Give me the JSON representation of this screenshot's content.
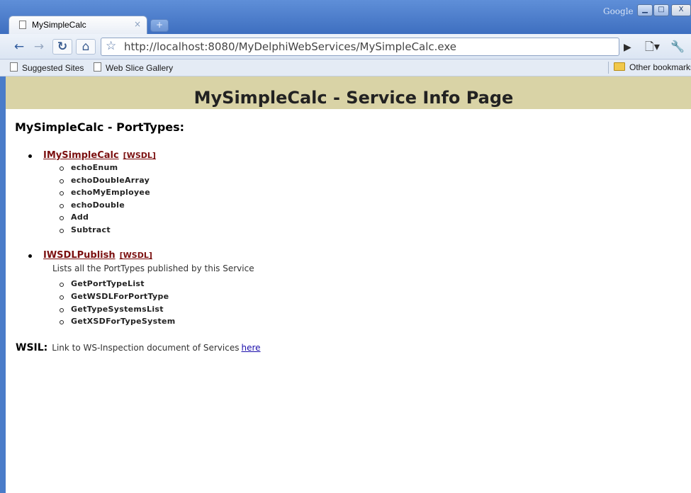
{
  "browser": {
    "tab_title": "MySimpleCalc",
    "tab_close": "×",
    "new_tab": "+",
    "brand": "Google",
    "window_controls": {
      "minimize": "▁",
      "maximize": "□",
      "close": "X"
    },
    "url": "http://localhost:8080/MyDelphiWebServices/MySimpleCalc.exe",
    "bookmarks": [
      {
        "label": "Suggested Sites"
      },
      {
        "label": "Web Slice Gallery"
      }
    ],
    "other_bookmarks": "Other bookmarks"
  },
  "page": {
    "title": "MySimpleCalc - Service Info Page",
    "porttypes_heading": "MySimpleCalc - PortTypes:",
    "porttypes": [
      {
        "name": "IMySimpleCalc",
        "wsdl_label": "[WSDL]",
        "description": "",
        "operations": [
          "echoEnum",
          "echoDoubleArray",
          "echoMyEmployee",
          "echoDouble",
          "Add",
          "Subtract"
        ]
      },
      {
        "name": "IWSDLPublish",
        "wsdl_label": "[WSDL]",
        "description": "Lists all the PortTypes published by this Service",
        "operations": [
          "GetPortTypeList",
          "GetWSDLForPortType",
          "GetTypeSystemsList",
          "GetXSDForTypeSystem"
        ]
      }
    ],
    "wsil": {
      "label": "WSIL:",
      "text": "Link to WS-Inspection document of Services",
      "link": "here"
    }
  },
  "colors": {
    "banner": "#d9d3a6",
    "link_dark_red": "#7b1010",
    "link_blue": "#1a0dab"
  }
}
